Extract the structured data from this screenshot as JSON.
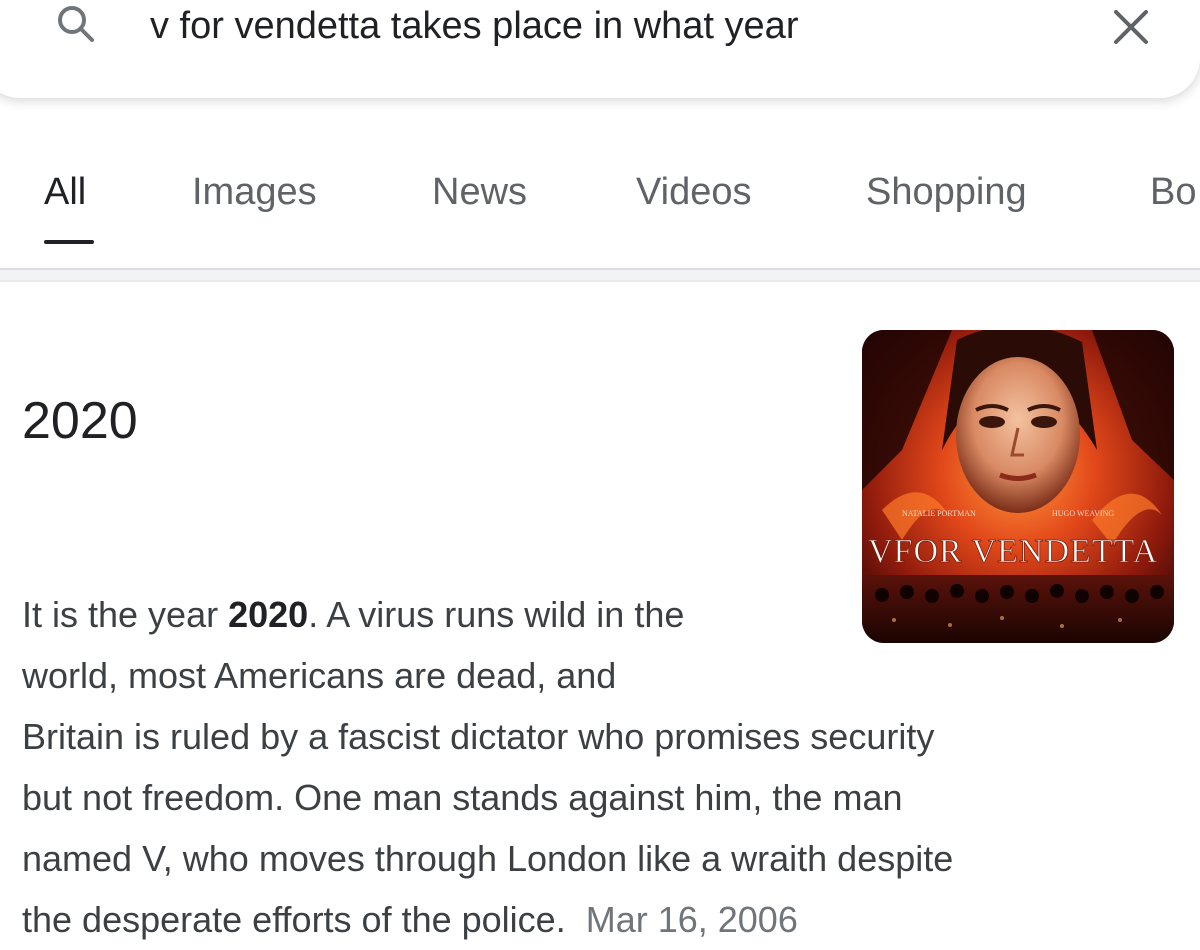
{
  "search": {
    "query": "v for vendetta takes place in what year"
  },
  "tabs": [
    {
      "label": "All",
      "active": true
    },
    {
      "label": "Images",
      "active": false
    },
    {
      "label": "News",
      "active": false
    },
    {
      "label": "Videos",
      "active": false
    },
    {
      "label": "Shopping",
      "active": false
    },
    {
      "label": "Bo",
      "active": false
    }
  ],
  "answer": {
    "title": "2020",
    "snippet": {
      "line1_pre": "It is the year ",
      "line1_bold": "2020",
      "line1_post": ". A virus runs wild in the",
      "line2": "world, most Americans are dead, and",
      "line3": "Britain is ruled by a fascist dictator who promises security",
      "line4": "but not freedom. One man stands against him, the man",
      "line5": "named V, who moves through London like a wraith despite",
      "line6": "the desperate efforts of the police.",
      "date": "Mar 16, 2006"
    },
    "thumbnail": {
      "alt": "movie poster",
      "poster_title": "VFOR VENDETTA",
      "credits_left": "NATALIE PORTMAN",
      "credits_right": "HUGO WEAVING"
    }
  },
  "colors": {
    "text_primary": "#202124",
    "text_secondary": "#5f6368",
    "snippet_text": "#3c4043",
    "date": "#70757a",
    "divider": "#dadce0"
  },
  "icons": {
    "search": "search-icon",
    "close": "close-icon"
  }
}
